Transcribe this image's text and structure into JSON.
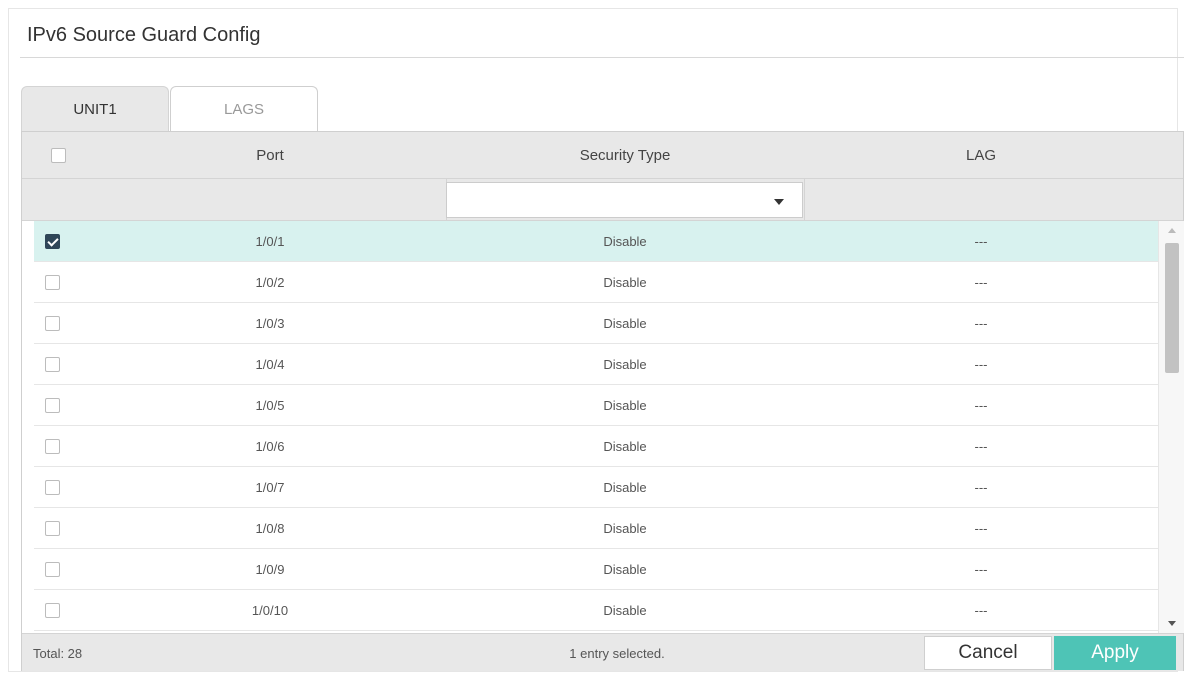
{
  "page": {
    "title": "IPv6 Source Guard Config"
  },
  "tabs": [
    {
      "label": "UNIT1",
      "active": true
    },
    {
      "label": "LAGS",
      "active": false
    }
  ],
  "table": {
    "headers": {
      "port": "Port",
      "security_type": "Security Type",
      "lag": "LAG"
    },
    "filter": {
      "security_type_value": ""
    },
    "rows": [
      {
        "port": "1/0/1",
        "security_type": "Disable",
        "lag": "---",
        "checked": true
      },
      {
        "port": "1/0/2",
        "security_type": "Disable",
        "lag": "---",
        "checked": false
      },
      {
        "port": "1/0/3",
        "security_type": "Disable",
        "lag": "---",
        "checked": false
      },
      {
        "port": "1/0/4",
        "security_type": "Disable",
        "lag": "---",
        "checked": false
      },
      {
        "port": "1/0/5",
        "security_type": "Disable",
        "lag": "---",
        "checked": false
      },
      {
        "port": "1/0/6",
        "security_type": "Disable",
        "lag": "---",
        "checked": false
      },
      {
        "port": "1/0/7",
        "security_type": "Disable",
        "lag": "---",
        "checked": false
      },
      {
        "port": "1/0/8",
        "security_type": "Disable",
        "lag": "---",
        "checked": false
      },
      {
        "port": "1/0/9",
        "security_type": "Disable",
        "lag": "---",
        "checked": false
      },
      {
        "port": "1/0/10",
        "security_type": "Disable",
        "lag": "---",
        "checked": false
      }
    ]
  },
  "footer": {
    "total": "Total: 28",
    "selection": "1 entry selected.",
    "cancel_label": "Cancel",
    "apply_label": "Apply"
  },
  "colors": {
    "accent": "#4ec4b6",
    "selected_row": "#d8f2ef",
    "checkbox_checked": "#2f4658"
  }
}
